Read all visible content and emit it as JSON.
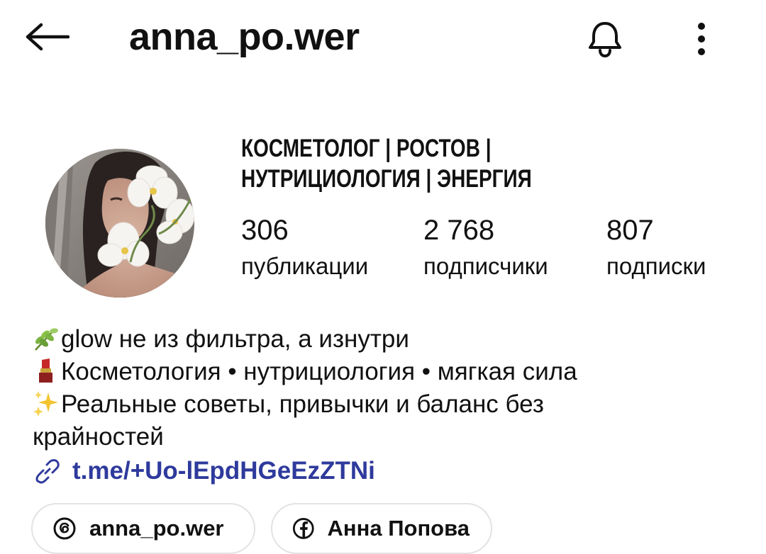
{
  "header": {
    "username": "anna_po.wer",
    "back_icon": "arrow-left-icon",
    "bell_icon": "bell-icon",
    "more_icon": "more-vertical-icon"
  },
  "profile": {
    "avatar_alt": "profile photo",
    "category_line1": "КОСМЕТОЛОГ | РОСТОВ |",
    "category_line2": "НУТРИЦИОЛОГИЯ | ЭНЕРГИЯ",
    "stats": {
      "posts_count": "306",
      "posts_label": "публикации",
      "followers_count": "2 768",
      "followers_label": "подписчики",
      "following_count": "807",
      "following_label": "подписки"
    }
  },
  "bio": {
    "line1": "glow не из фильтра, а изнутри",
    "line2": "Косметология • нутрициология • мягкая сила",
    "line3": "Реальные советы, привычки и баланс без крайностей",
    "line1_icon": "herb-icon",
    "line2_icon": "lipstick-icon",
    "line3_icon": "sparkles-icon"
  },
  "link": {
    "icon": "link-icon",
    "text": "t.me/+Uo-lEpdHGeEzZTNi",
    "color": "#2e3a9c"
  },
  "chips": {
    "threads_icon": "threads-icon",
    "threads_label": "anna_po.wer",
    "facebook_icon": "facebook-icon",
    "facebook_label": "Анна Попова"
  }
}
